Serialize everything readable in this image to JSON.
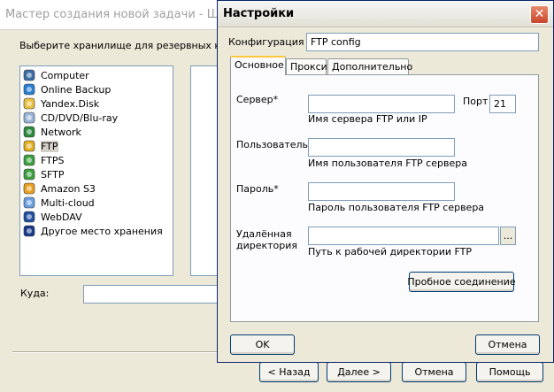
{
  "wizard": {
    "title": "Мастер создания новой задачи - Шаг",
    "prompt": "Выберите хранилище для резервных копий",
    "storage_items": [
      {
        "label": "Computer",
        "icon": "computer-icon",
        "color": "#3a6ea5"
      },
      {
        "label": "Online Backup",
        "icon": "globe-icon",
        "color": "#2a7fd4"
      },
      {
        "label": "Yandex.Disk",
        "icon": "yandex-disk-icon",
        "color": "#e8c040"
      },
      {
        "label": "CD/DVD/Blu-ray",
        "icon": "disc-icon",
        "color": "#9ab4d8"
      },
      {
        "label": "Network",
        "icon": "network-icon",
        "color": "#2a8a3c"
      },
      {
        "label": "FTP",
        "icon": "ftp-icon",
        "color": "#e0b020"
      },
      {
        "label": "FTPS",
        "icon": "ftps-icon",
        "color": "#3ca040"
      },
      {
        "label": "SFTP",
        "icon": "sftp-icon",
        "color": "#3ca040"
      },
      {
        "label": "Amazon S3",
        "icon": "amazon-s3-icon",
        "color": "#e8a020"
      },
      {
        "label": "Multi-cloud",
        "icon": "multi-cloud-icon",
        "color": "#6aa0e0"
      },
      {
        "label": "WebDAV",
        "icon": "webdav-icon",
        "color": "#2050a0"
      },
      {
        "label": "Другое место хранения",
        "icon": "search-globe-icon",
        "color": "#1a3a8a"
      }
    ],
    "selected_item": "FTP",
    "dest_label": "Куда:",
    "buttons": {
      "back": "< Назад",
      "next": "Далее >",
      "cancel": "Отмена",
      "help": "Помощь"
    }
  },
  "settings": {
    "title": "Настройки",
    "close_symbol": "✕",
    "config_label": "Конфигурация",
    "config_value": "FTP config",
    "tabs": [
      "Основное",
      "Прокси",
      "Дополнительно"
    ],
    "active_tab": "Основное",
    "server_label": "Сервер*",
    "server_value": "",
    "server_hint": "Имя сервера FTP или IP",
    "port_label": "Порт",
    "port_value": "21",
    "user_label": "Пользователь*",
    "user_value": "",
    "user_hint": "Имя пользователя FTP сервера",
    "password_label": "Пароль*",
    "password_value": "",
    "password_hint": "Пароль пользователя FTP сервера",
    "remote_dir_label_1": "Удалённая",
    "remote_dir_label_2": "директория",
    "remote_dir_value": "",
    "browse_label": "...",
    "remote_dir_hint": "Путь к рабочей директории FTP",
    "test_button": "Пробное соединение",
    "ok_button": "OK",
    "cancel_button": "Отмена"
  }
}
